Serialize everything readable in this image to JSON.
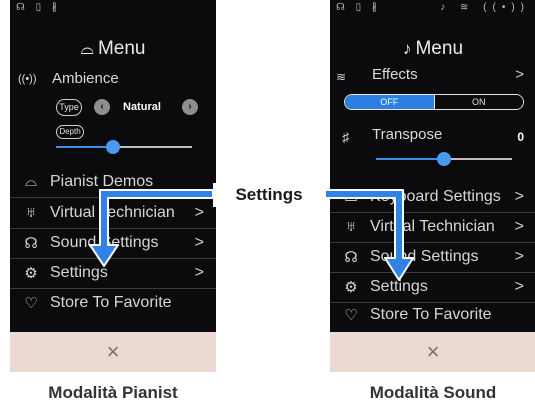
{
  "left": {
    "status_left": "☊ ▯ ∦",
    "menu_title": "Menu",
    "ambience_label": "Ambience",
    "type_label": "Type",
    "type_value": "Natural",
    "depth_label": "Depth",
    "depth_level": 0.42,
    "items": [
      {
        "label": "Pianist Demos",
        "chevron": ""
      },
      {
        "label": "Virtual Technician",
        "chevron": ">"
      },
      {
        "label": "Sound Settings",
        "chevron": ">"
      },
      {
        "label": "Settings",
        "chevron": ">"
      },
      {
        "label": "Store To Favorite",
        "chevron": ""
      }
    ],
    "close_glyph": "×",
    "caption": "Modalità Pianist"
  },
  "right": {
    "status_left": "☊ ▯ ∦",
    "status_right": "♪ ≋ ((•))",
    "menu_title": "Menu",
    "effects_label": "Effects",
    "effects_chevron": ">",
    "toggle_off": "OFF",
    "toggle_on": "ON",
    "transpose_label": "Transpose",
    "transpose_value": "0",
    "transpose_level": 0.5,
    "items": [
      {
        "label": "Keyboard Settings",
        "chevron": ">"
      },
      {
        "label": "Virtual Technician",
        "chevron": ">"
      },
      {
        "label": "Sound Settings",
        "chevron": ">"
      },
      {
        "label": "Settings",
        "chevron": ">"
      },
      {
        "label": "Store To Favorite",
        "chevron": ""
      }
    ],
    "close_glyph": "×",
    "caption": "Modalità Sound"
  },
  "callout": "Settings",
  "colors": {
    "accent": "#3d8ee6",
    "arrow_fill": "#2f82e6",
    "arrow_stroke": "#ffffff",
    "footer_bg": "#ebd9d2",
    "screen_bg": "#0b0b0d"
  },
  "icons": {
    "headphones": "headphones-icon",
    "ambience": "ambience-icon",
    "grand_piano": "grand-piano-icon",
    "virtual_technician": "technician-icon",
    "gear": "gear-icon",
    "heart": "heart-icon",
    "effects": "effects-icon",
    "transpose": "transpose-icon",
    "keyboard": "keyboard-icon",
    "close": "close-icon"
  }
}
